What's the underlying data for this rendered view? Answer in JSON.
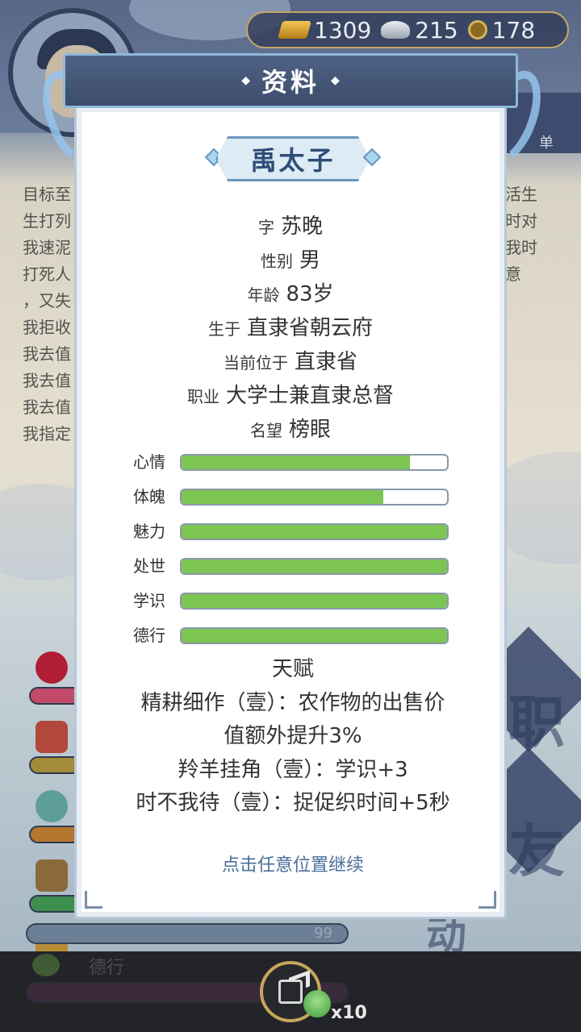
{
  "currency": {
    "gold": "1309",
    "silver": "215",
    "coin": "178"
  },
  "background": {
    "text_lines_left": [
      "目标至",
      "生打列",
      "我速泥",
      "打死人",
      "，又失",
      "我拒收",
      "我去值",
      "我去值",
      "我去值",
      "我指定"
    ],
    "text_lines_right": [
      "活生",
      "",
      "时对",
      "我时",
      "意"
    ],
    "right_banner_label": "单",
    "bottom_value": "99",
    "bottom_label": "德行",
    "big_glyphs": [
      "职",
      "友",
      "动"
    ],
    "frog_count": "x10"
  },
  "modal": {
    "title": "资料",
    "name": "禹太子",
    "info": [
      {
        "key": "字",
        "value": "苏晚"
      },
      {
        "key": "性别",
        "value": "男"
      },
      {
        "key": "年龄",
        "value": "83岁"
      },
      {
        "key": "生于",
        "value": "直隶省朝云府"
      },
      {
        "key": "当前位于",
        "value": "直隶省"
      },
      {
        "key": "职业",
        "value": "大学士兼直隶总督"
      },
      {
        "key": "名望",
        "value": "榜眼"
      }
    ],
    "stats": [
      {
        "label": "心情",
        "value": 0.86
      },
      {
        "label": "体魄",
        "value": 0.76
      },
      {
        "label": "魅力",
        "value": 1.0
      },
      {
        "label": "处世",
        "value": 1.0
      },
      {
        "label": "学识",
        "value": 1.0
      },
      {
        "label": "德行",
        "value": 1.0
      }
    ],
    "talent_title": "天赋",
    "talents": [
      "精耕细作（壹）：农作物的出售价",
      "值额外提升3%",
      "羚羊挂角（壹）：学识+3",
      "时不我待（壹）：捉促织时间+5秒"
    ],
    "continue_hint": "点击任意位置继续",
    "fill_color": "#7cc552",
    "accent_color": "#4a6f9a"
  }
}
